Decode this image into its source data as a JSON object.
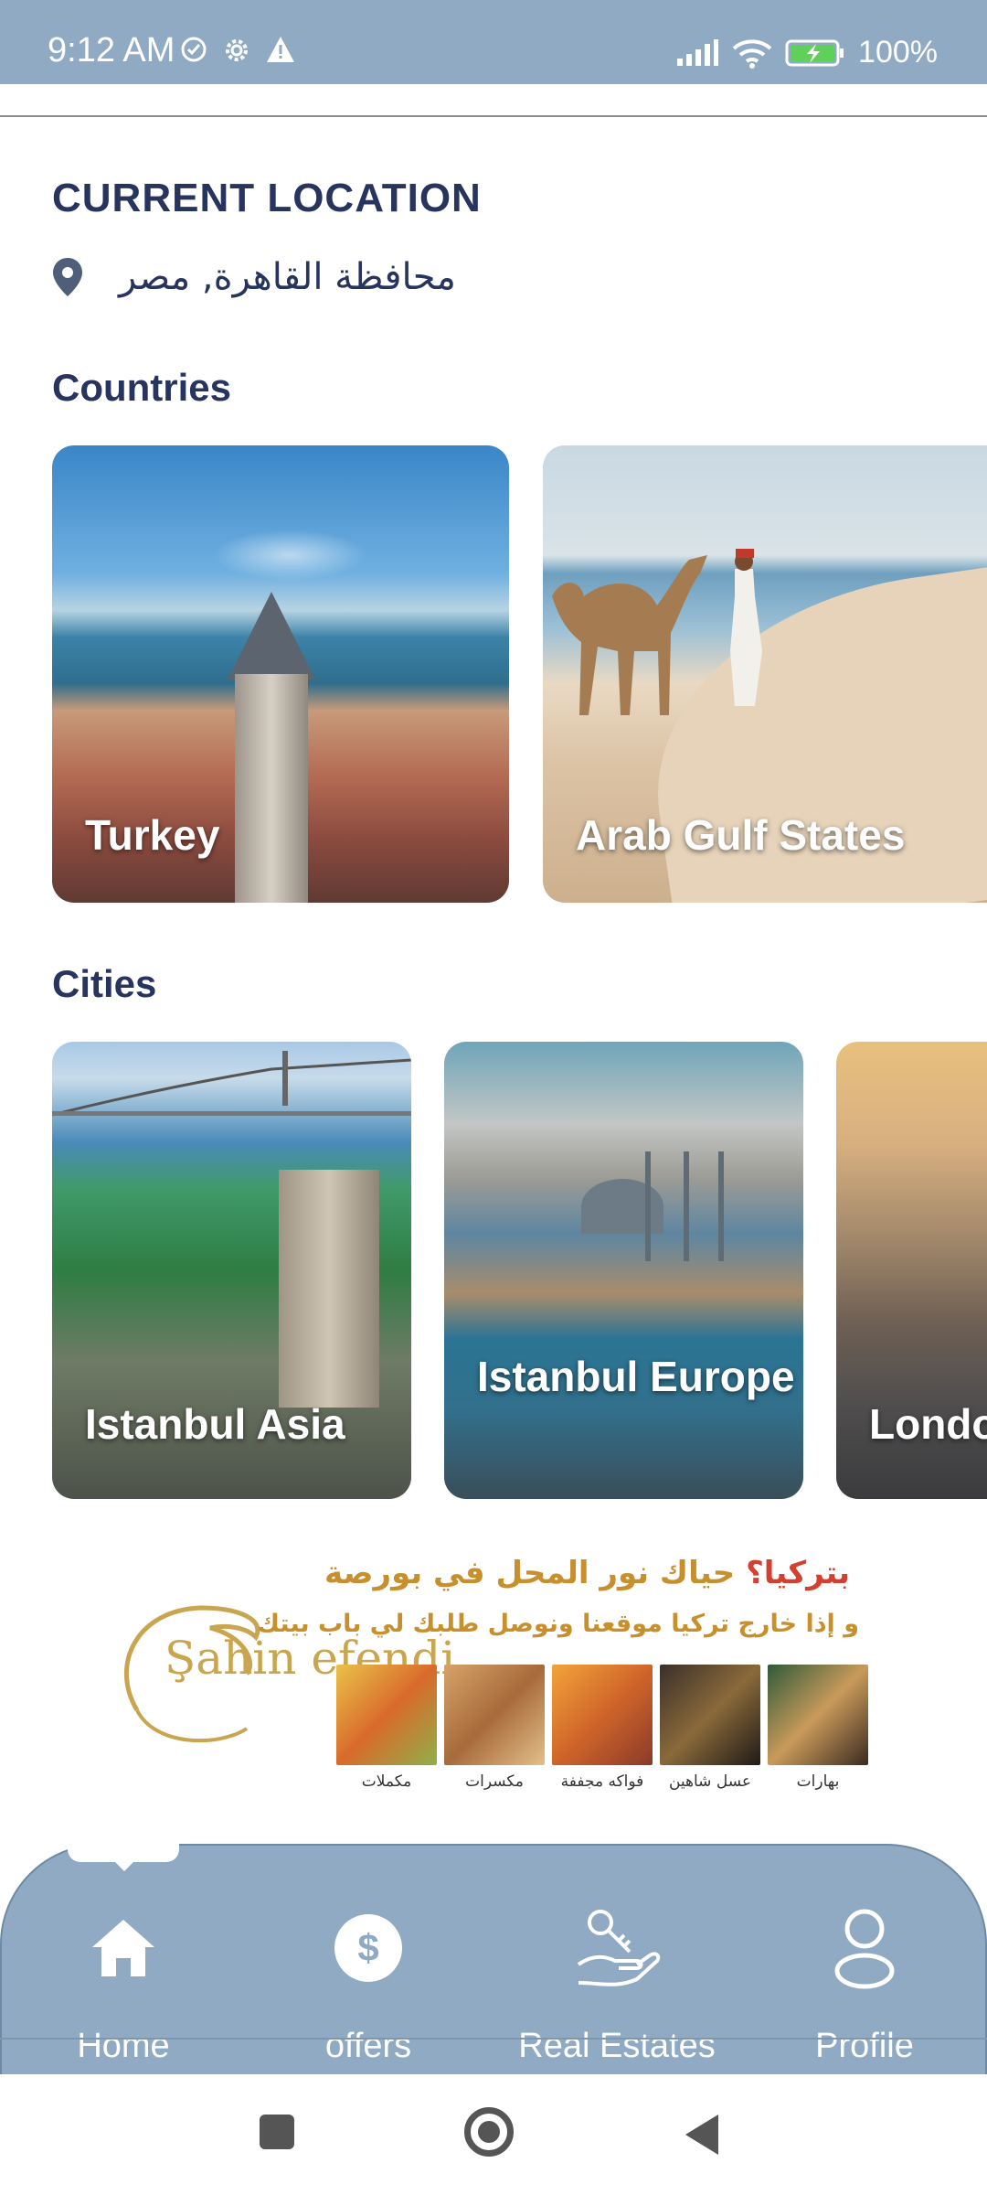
{
  "status_bar": {
    "time": "9:12 AM",
    "battery": "100%",
    "icons": [
      "check-circle-icon",
      "gear-icon",
      "warning-icon",
      "signal-icon",
      "wifi-icon",
      "battery-charging-icon"
    ]
  },
  "location": {
    "heading": "CURRENT LOCATION",
    "value": "محافظة القاهرة, مصر",
    "icon": "location-pin-icon"
  },
  "countries": {
    "heading": "Countries",
    "items": [
      {
        "label": "Turkey"
      },
      {
        "label": "Arab Gulf States"
      }
    ]
  },
  "cities": {
    "heading": "Cities",
    "items": [
      {
        "label": "Istanbul Asia"
      },
      {
        "label": "Istanbul Europe"
      },
      {
        "label": "London"
      }
    ]
  },
  "banner": {
    "brand": "Şahin efendi",
    "line1_accent": "بتركيا؟",
    "line1_rest": "حياك نور المحل في بورصة",
    "line2": "و إذا خارج تركيا موقعنا ونوصل طلبك لي باب بيتك",
    "products": [
      "مكملات",
      "مكسرات",
      "فواكه مجففة",
      "عسل شاهين",
      "بهارات"
    ]
  },
  "bottom_nav": {
    "items": [
      {
        "label": "Home",
        "icon": "home-icon"
      },
      {
        "label": "offers",
        "icon": "dollar-icon"
      },
      {
        "label": "Real Estates",
        "icon": "hand-key-icon"
      },
      {
        "label": "Profile",
        "icon": "user-icon"
      }
    ],
    "active": "Home"
  },
  "colors": {
    "bar": "#8faac2",
    "heading": "#27345e",
    "banner_gold": "#c7902c",
    "banner_red": "#d24031"
  }
}
